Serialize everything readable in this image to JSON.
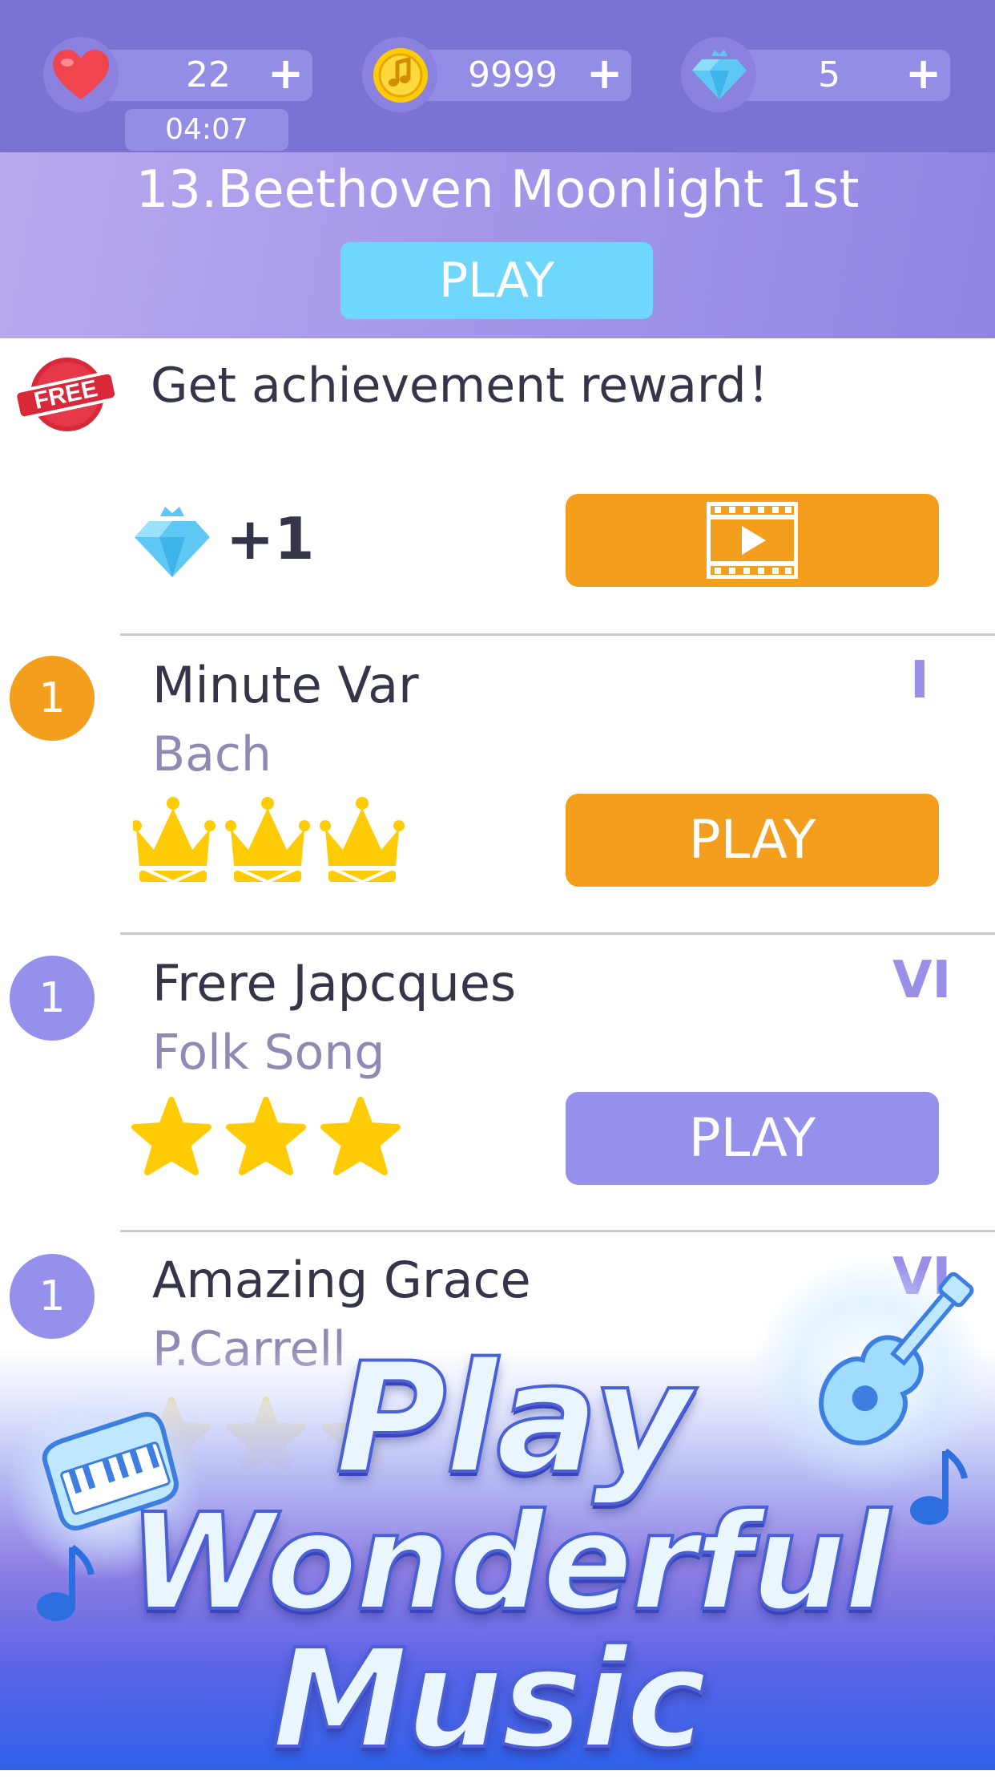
{
  "status_bar": {
    "lives": {
      "value": "22",
      "plus": "+",
      "timer": "04:07"
    },
    "coins": {
      "value": "9999",
      "plus": "+"
    },
    "diamonds": {
      "value": "5",
      "plus": "+"
    }
  },
  "hero": {
    "title": "13.Beethoven Moonlight 1st",
    "play_label": "PLAY"
  },
  "achievement": {
    "badge": "FREE",
    "title": "Get achievement reward！",
    "reward": "+1",
    "icons": {
      "reward": "diamond-icon",
      "video": "video-play-icon"
    }
  },
  "songs": [
    {
      "rank": "1",
      "title": "Minute Var",
      "artist": "Bach",
      "level": "I",
      "play_label": "PLAY",
      "rating": 3,
      "rating_icon": "crown-icon",
      "accent": "#f49e1d"
    },
    {
      "rank": "1",
      "title": "Frere Japcques",
      "artist": "Folk Song",
      "level": "VI",
      "play_label": "PLAY",
      "rating": 3,
      "rating_icon": "star-icon",
      "accent": "#9590ec"
    },
    {
      "rank": "1",
      "title": "Amazing Grace",
      "artist": "P.Carrell",
      "level": "VI",
      "rating": 3,
      "rating_icon": "star-icon",
      "accent": "#9590ec"
    }
  ],
  "promo": {
    "line1": "Play",
    "line2": "Wonderful",
    "line3": "Music"
  },
  "colors": {
    "top_bar": "#7b73d3",
    "hero_button": "#6fd6fd",
    "orange": "#f49e1d",
    "purple_button": "#9590ec",
    "gold": "#ffcb05",
    "heart": "#f0454f",
    "diamond": "#5ec8f5"
  }
}
